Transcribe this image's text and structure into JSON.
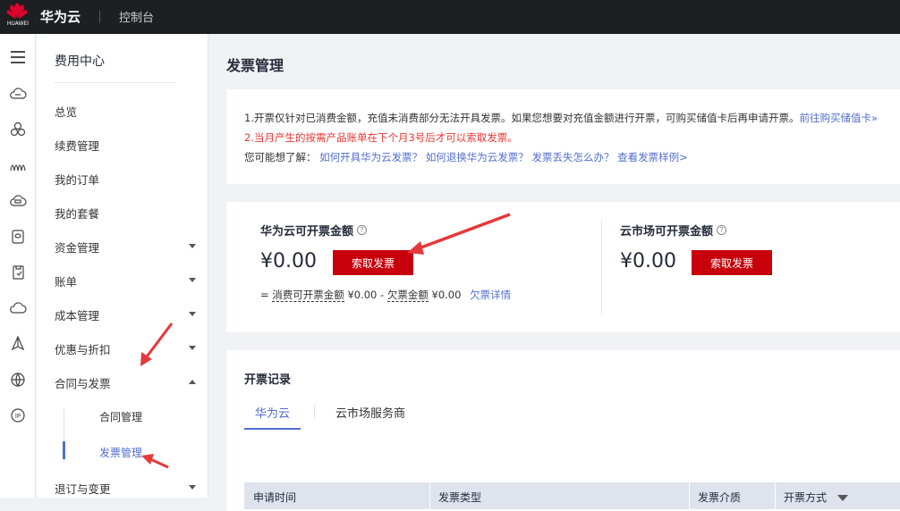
{
  "header": {
    "brand_small": "HUAWEI",
    "cloud_name": "华为云",
    "console": "控制台"
  },
  "sidebar": {
    "title": "费用中心",
    "items": [
      {
        "label": "总览"
      },
      {
        "label": "续费管理"
      },
      {
        "label": "我的订单"
      },
      {
        "label": "我的套餐"
      },
      {
        "label": "资金管理"
      },
      {
        "label": "账单"
      },
      {
        "label": "成本管理"
      },
      {
        "label": "优惠与折扣"
      },
      {
        "label": "合同与发票"
      },
      {
        "label": "退订与变更"
      }
    ],
    "subitems": [
      {
        "label": "合同管理"
      },
      {
        "label": "发票管理"
      }
    ]
  },
  "page": {
    "title": "发票管理"
  },
  "notice": {
    "line1": "1.开票仅针对已消费金额，充值未消费部分无法开具发票。如果您想要对充值金额进行开票，可购买储值卡后再申请开票。",
    "line1_link": "前往购买储值卡»",
    "line2": "2.当月产生的按需产品账单在下个月3号后才可以索取发票。",
    "line3_prefix": "您可能想了解：",
    "link_a": "如何开具华为云发票？",
    "link_b": "如何退换华为云发票？",
    "link_c": "发票丢失怎么办？",
    "link_d": "查看发票样例>"
  },
  "amounts": {
    "huawei": {
      "label": "华为云可开票金额",
      "value": "¥0.00",
      "button": "索取发票"
    },
    "market": {
      "label": "云市场可开票金额",
      "value": "¥0.00",
      "button": "索取发票"
    },
    "formula": {
      "eq": "= ",
      "consumed_label": "消费可开票金额",
      "consumed_value": " ¥0.00 - ",
      "owed_label": "欠票金额",
      "owed_value": " ¥0.00",
      "detail_link": "欠票详情"
    }
  },
  "records": {
    "title": "开票记录",
    "tabs": [
      {
        "label": "华为云"
      },
      {
        "label": "云市场服务商"
      }
    ],
    "columns": [
      "申请时间",
      "发票类型",
      "发票介质",
      "开票方式"
    ]
  },
  "colors": {
    "accent": "#526ecc",
    "brand_red": "#c7000b",
    "topbar": "#1e1f22",
    "arrow": "#e4393c"
  }
}
